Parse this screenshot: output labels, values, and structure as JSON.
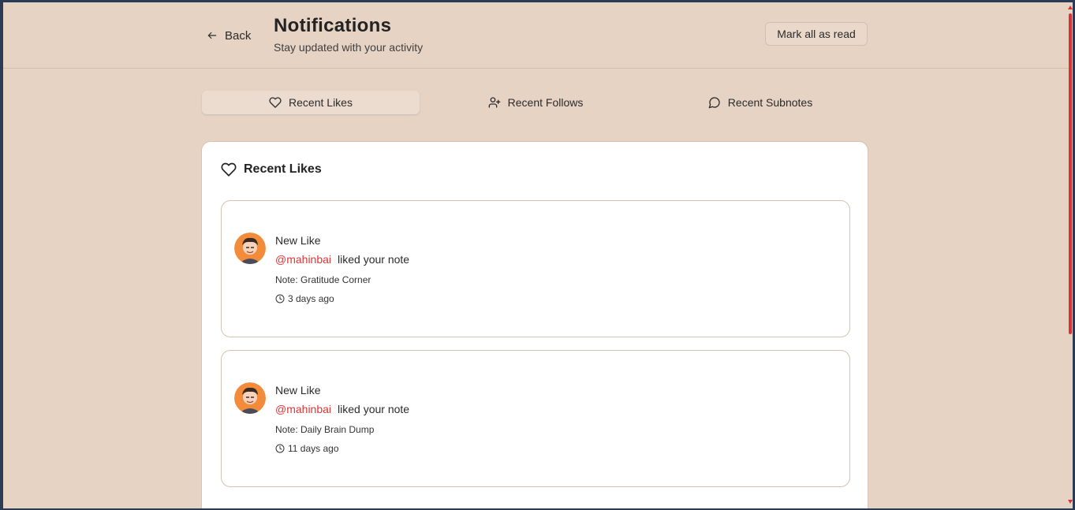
{
  "header": {
    "back_label": "Back",
    "title": "Notifications",
    "subtitle": "Stay updated with your activity",
    "mark_all_label": "Mark all as read"
  },
  "tabs": [
    {
      "label": "Recent Likes",
      "icon": "heart-icon",
      "active": true
    },
    {
      "label": "Recent Follows",
      "icon": "user-plus-icon",
      "active": false
    },
    {
      "label": "Recent Subnotes",
      "icon": "message-circle-icon",
      "active": false
    }
  ],
  "section": {
    "title": "Recent Likes",
    "icon": "heart-icon"
  },
  "notifications": [
    {
      "title": "New Like",
      "user": "@mahinbai",
      "action": "liked your note",
      "note": "Note: Gratitude Corner",
      "time": "3 days ago"
    },
    {
      "title": "New Like",
      "user": "@mahinbai",
      "action": "liked your note",
      "note": "Note: Daily Brain Dump",
      "time": "11 days ago"
    }
  ],
  "colors": {
    "background": "#e6d3c4",
    "accent": "#d93636",
    "card": "#ffffff",
    "scrollbar": "#e0302d"
  }
}
